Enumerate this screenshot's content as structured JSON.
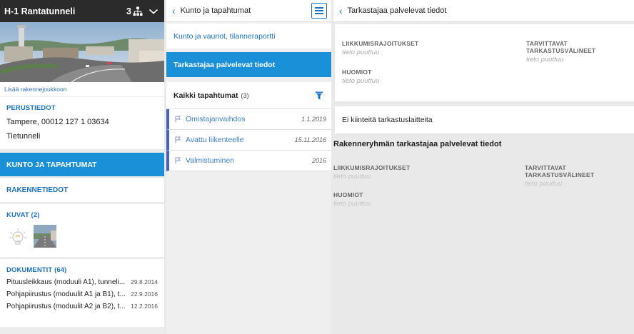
{
  "col1": {
    "header": {
      "title": "H-1 Rantatunneli",
      "count": "3"
    },
    "add_link": "Lisää rakennejoukkoon",
    "perustiedot": {
      "heading": "PERUSTIEDOT",
      "lines": [
        "Tampere, 00012 127 1 03634",
        "Tietunneli"
      ]
    },
    "nav_kunto": "KUNTO JA TAPAHTUMAT",
    "nav_rakenne": "RAKENNETIEDOT",
    "kuvat": {
      "heading": "KUVAT (2)"
    },
    "dokumentit": {
      "heading": "DOKUMENTIT (64)",
      "items": [
        {
          "title": "Pituusleikkaus (moduuli A1), tunneli...",
          "date": "29.8.2014"
        },
        {
          "title": "Pohjapiirustus (moduulit A1 ja B1), t...",
          "date": "22.9.2016"
        },
        {
          "title": "Pohjapiirustus (moduulit A2 ja B2), t...",
          "date": "12.2.2016"
        }
      ]
    }
  },
  "col2": {
    "header": {
      "title": "Kunto ja tapahtumat"
    },
    "link_kunto": "Kunto ja vauriot, tilanneraportti",
    "link_tarkastaja": "Tarkastajaa palvelevat tiedot",
    "events_label": "Kaikki tapahtumat",
    "events_count": "(3)",
    "events": [
      {
        "name": "Omistajanvaihdos",
        "date": "1.1.2019"
      },
      {
        "name": "Avattu liikenteelle",
        "date": "15.11.2016"
      },
      {
        "name": "Valmistuminen",
        "date": "2016"
      }
    ]
  },
  "col3": {
    "header": {
      "title": "Tarkastajaa palvelevat tiedot"
    },
    "fields": {
      "liikkumis_label": "LIIKKUMISRAJOITUKSET",
      "liikkumis_value": "tieto puuttuu",
      "valineet_label": "TARVITTAVAT TARKASTUSVÄLINEET",
      "valineet_value": "tieto puuttuu",
      "huomiot_label": "HUOMIOT",
      "huomiot_value": "tieto puuttuu"
    },
    "no_device": "Ei kiinteitä tarkastuslaitteita",
    "group_title": "Rakenneryhmän tarkastajaa palvelevat tiedot",
    "group_fields": {
      "liikkumis_label": "LIIKKUMISRAJOITUKSET",
      "liikkumis_value": "tieto puuttuu",
      "valineet_label": "TARVITTAVAT TARKASTUSVÄLINEET",
      "valineet_value": "tieto puuttuu",
      "huomiot_label": "HUOMIOT",
      "huomiot_value": "tieto puuttuu"
    }
  },
  "colors": {
    "accent": "#1a90d9",
    "link": "#1a73c4",
    "event_bar": "#4a5ec7",
    "header_dark": "#2b2b2b"
  },
  "icons": {
    "hierarchy": "hierarchy-icon",
    "chevron": "chevron-down-icon",
    "back": "back-arrow-icon",
    "menu": "menu-icon",
    "filter": "filter-icon",
    "flag": "flag-icon"
  }
}
